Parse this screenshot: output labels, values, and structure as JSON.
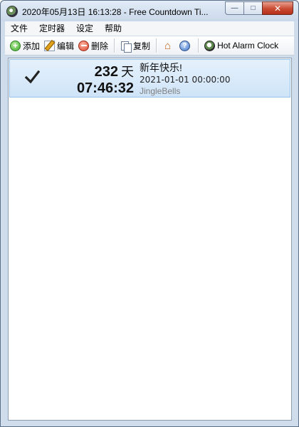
{
  "window": {
    "title": "2020年05月13日 16:13:28 - Free Countdown Ti...",
    "caption": {
      "minimize": "—",
      "maximize": "□",
      "close": "✕"
    }
  },
  "menu": [
    "文件",
    "定时器",
    "设定",
    "帮助"
  ],
  "toolbar": {
    "add_label": "添加",
    "edit_label": "编辑",
    "delete_label": "删除",
    "copy_label": "复制",
    "hot_alarm_label": "Hot Alarm Clock"
  },
  "countdowns": [
    {
      "checked": true,
      "days": "232",
      "days_unit": "天",
      "time_left": "07:46:32",
      "name": "新年快乐!",
      "target_datetime": "2021-01-01 00:00:00",
      "sound": "JingleBells"
    }
  ],
  "colors": {
    "selection_bg": "#d3e6f9",
    "selection_border": "#9cc4ea",
    "sound_text": "#7f7f7f"
  }
}
